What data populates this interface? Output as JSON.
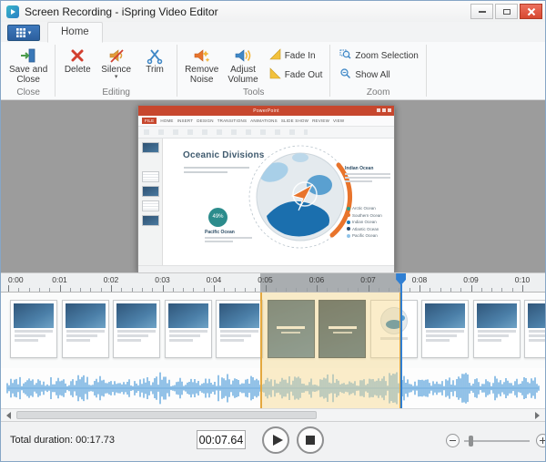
{
  "window": {
    "title": "Screen Recording - iSpring Video Editor"
  },
  "icons": {
    "caret_down": "▾"
  },
  "ribbon": {
    "active_tab": "Home",
    "groups": [
      {
        "label": "Close",
        "buttons": [
          {
            "line1": "Save and",
            "line2": "Close"
          }
        ]
      },
      {
        "label": "Editing",
        "buttons": [
          {
            "line1": "Delete",
            "line2": ""
          },
          {
            "line1": "Silence",
            "line2": "",
            "dropdown": true
          },
          {
            "line1": "Trim",
            "line2": ""
          }
        ]
      },
      {
        "label": "Tools",
        "buttons": [
          {
            "line1": "Remove",
            "line2": "Noise"
          },
          {
            "line1": "Adjust",
            "line2": "Volume"
          }
        ],
        "small_buttons": [
          {
            "label": "Fade In"
          },
          {
            "label": "Fade Out"
          }
        ]
      },
      {
        "label": "Zoom",
        "small_buttons": [
          {
            "label": "Zoom Selection"
          },
          {
            "label": "Show All"
          }
        ]
      }
    ]
  },
  "preview": {
    "ppt": {
      "window_title": "PowerPoint",
      "tabs": [
        "FILE",
        "HOME",
        "INSERT",
        "DESIGN",
        "TRANSITIONS",
        "ANIMATIONS",
        "SLIDE SHOW",
        "REVIEW",
        "VIEW"
      ],
      "slide_title": "Oceanic Divisions",
      "right_callout_title": "Indian Ocean",
      "bottom_callout_title": "Pacific Ocean",
      "badge": "49%",
      "legend": [
        {
          "label": "Arctic Ocean",
          "color": "#2a9d8f"
        },
        {
          "label": "Southern Ocean",
          "color": "#e8742c"
        },
        {
          "label": "Indian Ocean",
          "color": "#1e78b4"
        },
        {
          "label": "Atlantic Ocean",
          "color": "#27496d"
        },
        {
          "label": "Pacific Ocean",
          "color": "#8fc3e8"
        }
      ]
    }
  },
  "timeline": {
    "ruler_labels": [
      "0:00",
      "0:01",
      "0:02",
      "0:03",
      "0:04",
      "0:05",
      "0:06",
      "0:07",
      "0:08",
      "0:09",
      "0:10"
    ],
    "selection_start_s": 4.9,
    "selection_end_s": 7.64,
    "video_thumbnails": [
      "doc",
      "doc",
      "doc",
      "doc",
      "doc",
      "ocean",
      "ocean-dark",
      "globe",
      "doc",
      "doc",
      "doc"
    ]
  },
  "statusbar": {
    "total_duration_label": "Total duration:",
    "total_duration_value": "00:17.73",
    "current_time": "00:07.64"
  },
  "colors": {
    "waveform": "#4d9bd9",
    "selection_fill": "#f7d98a",
    "selection_border": "#e4a83e",
    "playhead": "#2f7fd3",
    "ppt_accent": "#c7472e"
  }
}
